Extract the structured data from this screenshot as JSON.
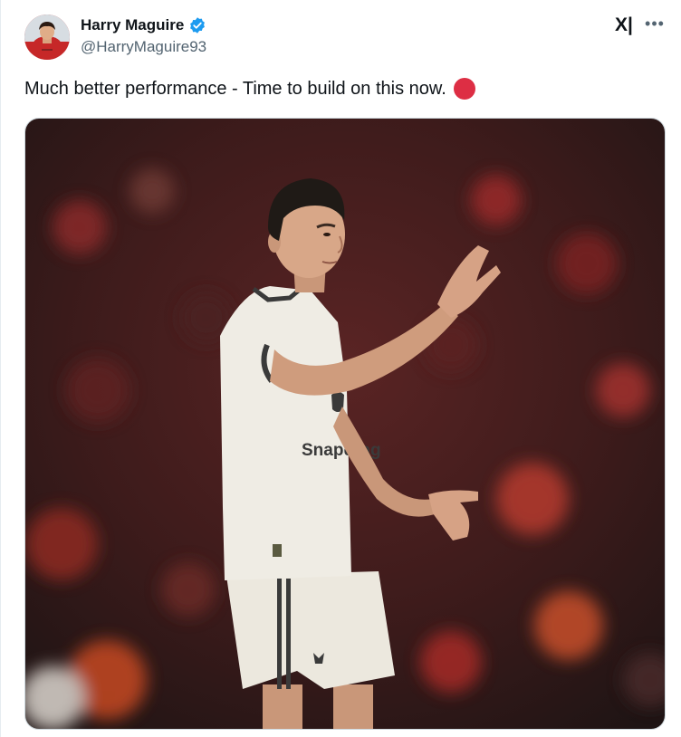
{
  "author": {
    "display_name": "Harry Maguire",
    "handle": "@HarryMaguire93",
    "verified": true,
    "verified_color": "#1d9bf0"
  },
  "tweet": {
    "text": "Much better performance - Time to build on this now.",
    "emoji": "red-circle",
    "emoji_color": "#dd2e44"
  },
  "media": {
    "kit_sponsor_text": "Snapdrag",
    "kit_color": "#efece4",
    "background_dominant": "#6b1a1a"
  },
  "icons": {
    "platform_logo": "x-logo",
    "more": "more-options-icon"
  },
  "logo_text": "X|"
}
